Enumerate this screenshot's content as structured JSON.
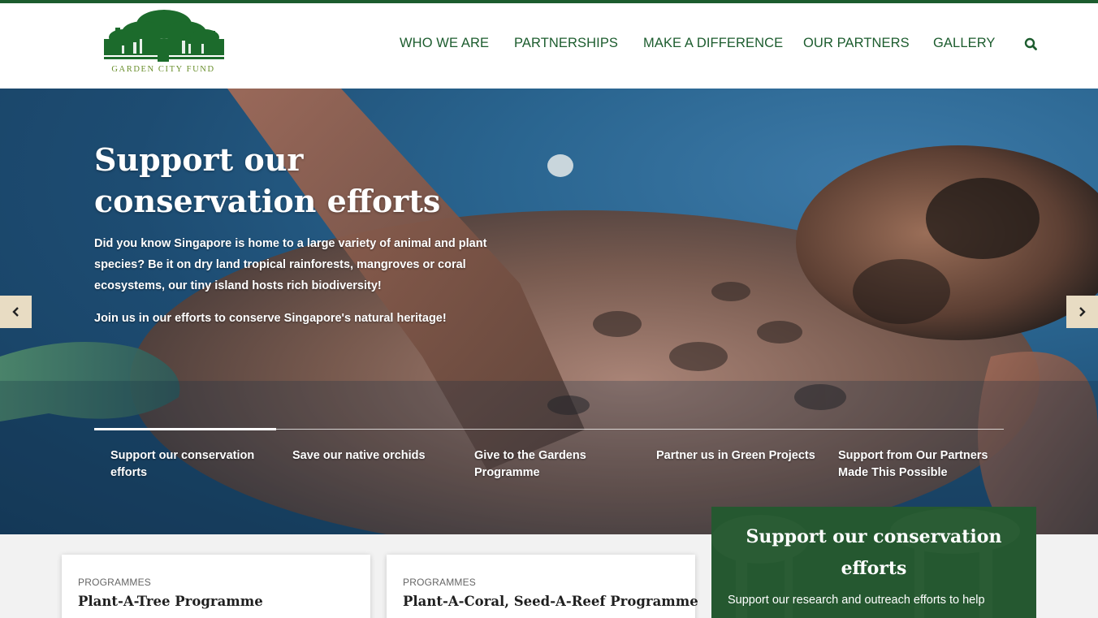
{
  "colors": {
    "brand_green": "#1c5c2e",
    "arrow_bg": "#e8dcc3",
    "promo_green": "#2b5f35"
  },
  "logo": {
    "text": "GARDEN CITY FUND",
    "icon": "tree-logo-icon"
  },
  "nav": {
    "items": [
      "WHO WE ARE",
      "PARTNERSHIPS",
      "MAKE A DIFFERENCE",
      "OUR PARTNERS",
      "GALLERY"
    ],
    "search_icon": "search-icon"
  },
  "hero": {
    "title": "Support our conservation efforts",
    "paragraph1": "Did you know Singapore is home to a large variety of animal and plant species? Be it on dry land tropical rainforests, mangroves or coral ecosystems, our tiny island hosts rich biodiversity!",
    "paragraph2": "Join us in our efforts to conserve Singapore's natural heritage!",
    "prev_icon": "chevron-left-icon",
    "next_icon": "chevron-right-icon",
    "tabs": [
      "Support our conservation efforts",
      "Save our native orchids",
      "Give to the Gardens Programme",
      "Partner us in Green Projects",
      "Support from Our Partners Made This Possible"
    ],
    "active_tab": 0
  },
  "cards": [
    {
      "category": "PROGRAMMES",
      "title": "Plant-A-Tree Programme"
    },
    {
      "category": "PROGRAMMES",
      "title": "Plant-A-Coral, Seed-A-Reef Programme"
    }
  ],
  "promo": {
    "title": "Support our conservation efforts",
    "text": "Support our research and outreach efforts to help"
  }
}
